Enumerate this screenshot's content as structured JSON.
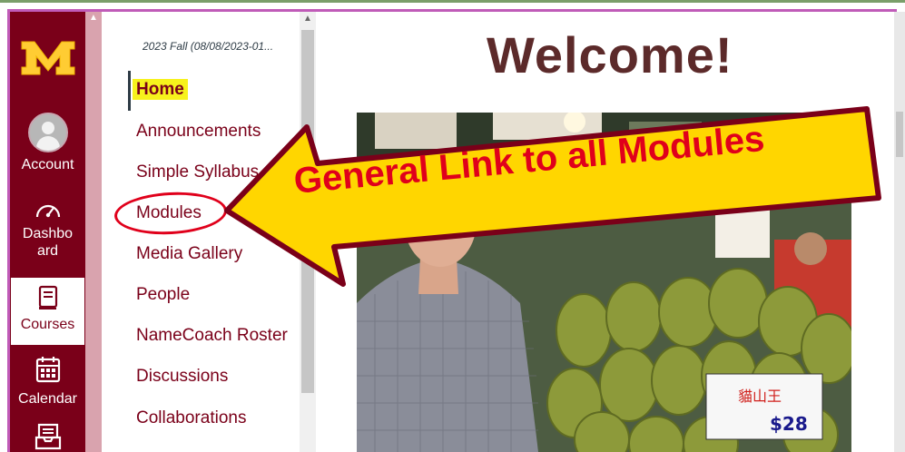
{
  "global_nav": {
    "items": [
      {
        "label": "Account",
        "icon": "user-avatar-icon"
      },
      {
        "label": "Dashboard",
        "icon": "dashboard-gauge-icon"
      },
      {
        "label": "Courses",
        "icon": "book-icon",
        "active": true
      },
      {
        "label": "Calendar",
        "icon": "calendar-icon"
      },
      {
        "label": "",
        "icon": "inbox-icon"
      }
    ],
    "logo": "university-m-logo",
    "brand_color": "#7a0019",
    "accent_color": "#ffcc33"
  },
  "course_nav": {
    "term": "2023 Fall (08/08/2023-01...",
    "items": [
      {
        "label": "Home",
        "active": true
      },
      {
        "label": "Announcements"
      },
      {
        "label": "Simple Syllabus"
      },
      {
        "label": "Modules"
      },
      {
        "label": "Media Gallery"
      },
      {
        "label": "People"
      },
      {
        "label": "NameCoach Roster"
      },
      {
        "label": "Discussions"
      },
      {
        "label": "Collaborations"
      }
    ]
  },
  "main": {
    "heading": "Welcome!",
    "photo": {
      "price_sign": "$28",
      "price_sign_text": "貓山王"
    }
  },
  "annotation": {
    "callout_text": "General Link to all Modules",
    "callout_fill": "#ffd600",
    "callout_border": "#7a0019",
    "callout_text_color": "#e0001b"
  }
}
